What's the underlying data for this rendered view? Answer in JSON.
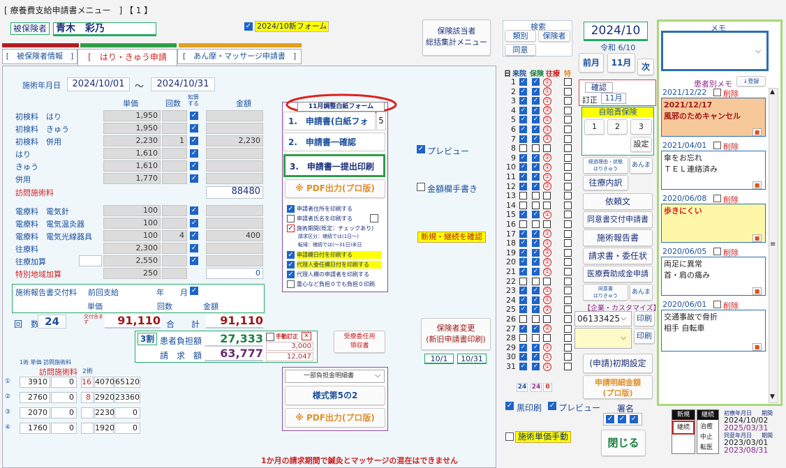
{
  "window": {
    "title": "[ 療養費支給申請書メニュー　] 【 1 】"
  },
  "patient": {
    "label": "被保険者",
    "name": "青木　彩乃"
  },
  "new_form_label": "2024/10新フォーム",
  "tabs": [
    "[　被保険者情報　]",
    "[　はり・きゅう申請書　]",
    "[　あん摩・マッサージ申請書　]"
  ],
  "period": {
    "label": "施術年月日",
    "from": "2024/10/01",
    "sep": "〜",
    "to": "2024/10/31"
  },
  "cols": {
    "unit": "単価",
    "count": "回数",
    "chikyo": "知算する",
    "amount": "金額"
  },
  "fee_rows": [
    {
      "label": "初検料　はり",
      "unit": "1,950",
      "count": "",
      "amount": ""
    },
    {
      "label": "初検料　きゅう",
      "unit": "1,950",
      "count": "",
      "amount": ""
    },
    {
      "label": "初検料　併用",
      "unit": "2,230",
      "count": "1",
      "amount": "2,230"
    },
    {
      "label": "はり",
      "unit": "1,610",
      "count": "",
      "amount": ""
    },
    {
      "label": "きゅう",
      "unit": "1,610",
      "count": "",
      "amount": ""
    },
    {
      "label": "併用",
      "unit": "1,770",
      "count": "",
      "amount": ""
    }
  ],
  "visit_fee": {
    "label": "訪問施術料",
    "amount": "88480"
  },
  "elec_rows": [
    {
      "label": "電療料　電気針",
      "unit": "100",
      "count": "",
      "amount": ""
    },
    {
      "label": "電療料　電気温灸器",
      "unit": "100",
      "count": "",
      "amount": ""
    },
    {
      "label": "電療料　電気光線器具",
      "unit": "100",
      "count": "4",
      "amount": "400"
    },
    {
      "label": "往療料",
      "unit": "2,300",
      "count": "",
      "amount": ""
    },
    {
      "label": "往療加算",
      "unit": "2,550",
      "count": "",
      "amount": ""
    },
    {
      "label": "特別地域加算",
      "unit": "250",
      "count": "",
      "amount": "0"
    }
  ],
  "report": {
    "label": "施術報告書交付料",
    "prev": "前回支給",
    "year": "年",
    "month": "月",
    "unit": "単価",
    "count": "回数",
    "amount": "金額"
  },
  "totals": {
    "count_label": "回　数",
    "count": "24",
    "per_label": "交付含まず",
    "sum1": "91,110",
    "total_label": "合　　計",
    "sum2": "91,110"
  },
  "burden": {
    "ratio": "3割",
    "patient_label": "患者負担額",
    "patient": "27,333",
    "claim_label": "請　求　額",
    "claim": "63,777",
    "manual": "手動訂正",
    "manual_x": "✕",
    "v1": "3,000",
    "v2": "12,047"
  },
  "ninin": {
    "label1": "受療委任用",
    "label2": "領収書"
  },
  "visit_table": {
    "hdr1": "1術 単価 訪問施術料",
    "hdr2": "訪問施術料",
    "hdr3": "2術",
    "rows": [
      {
        "n": "①",
        "a": "3910",
        "b": "0",
        "c": "16",
        "d": "4070",
        "e": "65120"
      },
      {
        "n": "②",
        "a": "2760",
        "b": "0",
        "c": "8",
        "d": "2920",
        "e": "23360"
      },
      {
        "n": "③",
        "a": "2070",
        "b": "0",
        "c": "",
        "d": "2230",
        "e": "0"
      },
      {
        "n": "④",
        "a": "1760",
        "b": "0",
        "c": "",
        "d": "1920",
        "e": "0"
      }
    ]
  },
  "print": {
    "adjust": "11月調整白紙フォーム",
    "b1": "1.　申請書(白紙フォー",
    "b1n": "5",
    "b2": "2.　申請書一確認",
    "b3": "3.　申請書一提出印刷",
    "pdf": "※ PDF出力(プロ版)",
    "options": [
      "申請者住所を印刷する",
      "申請者氏名を印刷する",
      "施術期間(既定：チェックあり)",
      "請求区分：継続では(1日〜)",
      "転帰：継続では(〜31日)末日",
      "申請欄日付を印刷する",
      "代理人委任欄日付を印刷する",
      "代理人欄の申請者を印刷する",
      "重心など負担０でも負担０印刷"
    ]
  },
  "preview": "プレビュー",
  "kinkaku": "金額欄手書き",
  "shinki": "新規・継続を確認",
  "hoken_menu": [
    "保険該当者",
    "総括集計メニュー"
  ],
  "hoken_change": [
    "保険者変更",
    "(新旧申請書印刷)"
  ],
  "dates_small": [
    "10/1",
    "10/31"
  ],
  "bottom": {
    "select": "一部負担金明細書",
    "form5": "様式第5の2",
    "pdf": "※ PDF出力(プロ版)",
    "note": "1か月の請求期間で鍼灸とマッサージの混在はできません"
  },
  "search": {
    "title": "検索",
    "b1": "類別",
    "b2": "保険者",
    "b3": "同意"
  },
  "date": {
    "ym": "2024/10",
    "reiwa": "令和 6/10",
    "prev": "前月",
    "cur": "11月",
    "next": "次"
  },
  "cal_header": [
    "日",
    "来院",
    "保険",
    "往療",
    "特"
  ],
  "cal_totals": [
    "24",
    "24",
    "0"
  ],
  "kakunin": {
    "title": "確認",
    "teisei": "訂正",
    "month": "11月"
  },
  "jibai": {
    "title": "自賠責保険",
    "b": [
      "1",
      "2",
      "3"
    ],
    "settei": "設定"
  },
  "side": {
    "keika": "経過理由・状態",
    "harikyu": "はりきゅう",
    "anma": "あんま",
    "ouryo": "往療内訳",
    "irai": "依頼文",
    "doui": "同意書交付申請書",
    "sejutsu": "施術報告書",
    "seikyu": "請求書・委任状",
    "iryo": "医療費助成金申請",
    "doui2": "同意書",
    "kigyo": "【企業・カスタマイズ】",
    "code": "06133425",
    "insatsu": "印刷",
    "shoki": "(申請)初期設定",
    "meisai1": "申請明細金額",
    "meisai2": "(プロ版)"
  },
  "bottom_right": {
    "kuro": "黒印刷",
    "preview": "プレビュー",
    "shomei": "署名",
    "tanka": "施術単価手動",
    "close": "閉じる"
  },
  "status": {
    "shinki": "新規",
    "keizoku": "継続",
    "keizoku2": "継続",
    "chiyu": "治癒",
    "chushi": "中止",
    "tenki": "転医",
    "first_label": "初療年月日",
    "kikan": "期間",
    "d1": "2024/10/02",
    "d2": "2025/03/31",
    "doui_label": "同意年月日",
    "d3": "2023/03/01",
    "d4": "2023/08/31"
  },
  "memo": {
    "title": "メモ",
    "kanja": "患者別メモ",
    "reg": "↓登録",
    "del": "削除",
    "entries": [
      {
        "date": "2021/12/22",
        "text": "2021/12/17\n風邪のためキャンセル",
        "bg": "#f7c89a"
      },
      {
        "date": "2021/04/01",
        "text": "傘をお忘れ\nＴＥＬ連絡済み",
        "bg": "#ffffff"
      },
      {
        "date": "2020/06/08",
        "text": "歩きにくい",
        "bg": "#fff7a8"
      },
      {
        "date": "2020/06/05",
        "text": "両足に異常\n首・肩の痛み",
        "bg": "#ffffff"
      },
      {
        "date": "2020/06/01",
        "text": "交通事故で骨折\n相手 自転車",
        "bg": "#ffffff"
      }
    ]
  }
}
